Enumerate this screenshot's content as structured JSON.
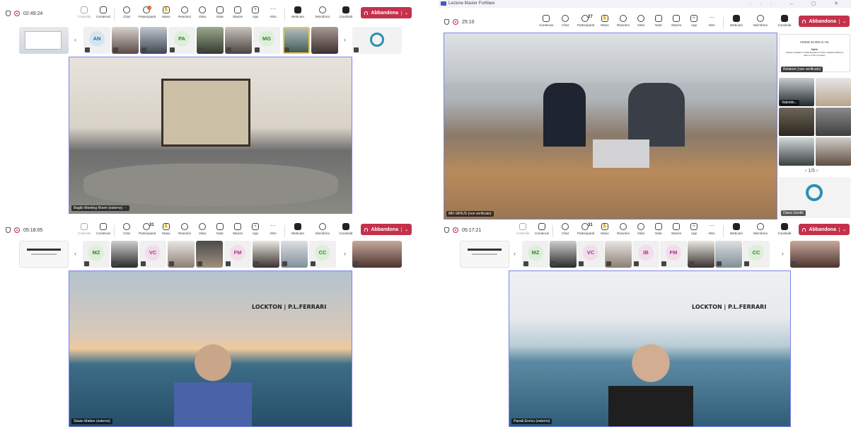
{
  "colors": {
    "leave": "#c4314b",
    "stage_border": "#7b83eb",
    "rec": "#c4314b",
    "badge": "#e3663d"
  },
  "panels": [
    {
      "timer": "02:49:24",
      "tools": {
        "controllo": "Controllo",
        "contenuti": "Contenuti",
        "chat": "Chat",
        "partecipanti": "Partecipanti",
        "mano": "Mano",
        "reazioni": "Reazioni",
        "vista": "Vista",
        "note": "Note",
        "stanze": "Stanze",
        "app": "App",
        "altro": "Altro",
        "webcam": "Webcam",
        "microfono": "Microfono",
        "condividi": "Condividi"
      },
      "leave": "Abbandona",
      "strip_initials": [
        "AN",
        "PA",
        "MG"
      ],
      "stage_name": "Baglio Meeting Room (esterno) ···"
    },
    {
      "window_title": "Lezione Master ForMare",
      "timer": "25:10",
      "participants_count": "27",
      "tools": {
        "contenuti": "Contenuti",
        "chat": "Chat",
        "partecipanti": "Partecipanti",
        "mano": "Mano",
        "reazioni": "Reazioni",
        "vista": "Vista",
        "note": "Note",
        "stanze": "Stanze",
        "app": "App",
        "altro": "Altro",
        "webcam": "Webcam",
        "microfono": "Microfono",
        "condividi": "Condividi"
      },
      "leave": "Abbandona",
      "stage_name": "MR-SIRIUS (non verificato)",
      "slide_title": "CREW as RM or HC",
      "slide_head": "Note",
      "slide_text": "Hoaster Capitale is Huda Reclama 4 Anica, Italianas Offcomo parnor of the Company",
      "relatore": "Relatore (non verificato)",
      "gallery_name": "Valentin...",
      "pager": "1/5",
      "bottom_name": "Diana Gentili"
    },
    {
      "timer": "05:18:05",
      "participants_count": "31",
      "tools": {
        "controllo": "Controllo",
        "contenuti": "Contenuti",
        "chat": "Chat",
        "partecipanti": "Partecipanti",
        "mano": "Mano",
        "reazioni": "Reazioni",
        "vista": "Vista",
        "note": "Note",
        "stanze": "Stanze",
        "app": "App",
        "altro": "Altro",
        "webcam": "Webcam",
        "microfono": "Microfono",
        "condividi": "Condividi"
      },
      "leave": "Abbandona",
      "strip_initials": [
        "MZ",
        "VC",
        "FM",
        "CC"
      ],
      "logo_left": "LOCKTON",
      "logo_right": "P.L.FERRARI",
      "stage_name": "Stasio Matteo (esterno)"
    },
    {
      "timer": "05:17:21",
      "participants_count": "31",
      "tools": {
        "controllo": "Controllo",
        "contenuti": "Contenuti",
        "chat": "Chat",
        "partecipanti": "Partecipanti",
        "mano": "Mano",
        "reazioni": "Reazioni",
        "vista": "Vista",
        "note": "Note",
        "stanze": "Stanze",
        "app": "App",
        "altro": "Altro",
        "webcam": "Webcam",
        "microfono": "Microfono",
        "condividi": "Condividi"
      },
      "leave": "Abbandona",
      "strip_initials": [
        "MZ",
        "VC",
        "IB",
        "FM",
        "CC"
      ],
      "logo_left": "LOCKTON",
      "logo_right": "P.L.FERRARI",
      "stage_name": "Parodi Enrico (esterno)"
    }
  ]
}
